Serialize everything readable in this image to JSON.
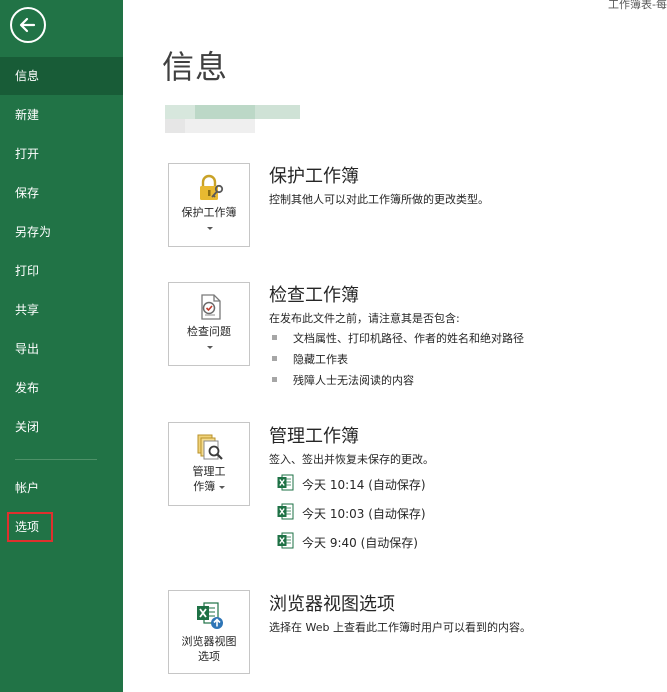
{
  "window": {
    "top_caption": "工作簿表-每"
  },
  "sidebar": {
    "items": [
      {
        "id": "info",
        "label": "信息"
      },
      {
        "id": "new",
        "label": "新建"
      },
      {
        "id": "open",
        "label": "打开"
      },
      {
        "id": "save",
        "label": "保存"
      },
      {
        "id": "save-as",
        "label": "另存为"
      },
      {
        "id": "print",
        "label": "打印"
      },
      {
        "id": "share",
        "label": "共享"
      },
      {
        "id": "export",
        "label": "导出"
      },
      {
        "id": "publish",
        "label": "发布"
      },
      {
        "id": "close",
        "label": "关闭"
      },
      {
        "id": "account",
        "label": "帐户"
      },
      {
        "id": "options",
        "label": "选项"
      }
    ],
    "active": "信息",
    "highlighted": "选项"
  },
  "main": {
    "title": "信息",
    "protect": {
      "card_label": "保护工作簿",
      "title": "保护工作簿",
      "description": "控制其他人可以对此工作簿所做的更改类型。"
    },
    "inspect": {
      "card_label": "检查问题",
      "title": "检查工作簿",
      "description": "在发布此文件之前，请注意其是否包含:",
      "bullets": [
        "文档属性、打印机路径、作者的姓名和绝对路径",
        "隐藏工作表",
        "残障人士无法阅读的内容"
      ]
    },
    "manage": {
      "card_label_line1": "管理工",
      "card_label_line2": "作簿",
      "title": "管理工作簿",
      "description": "签入、签出并恢复未保存的更改。",
      "versions": [
        "今天 10:14 (自动保存)",
        "今天 10:03 (自动保存)",
        "今天 9:40 (自动保存)"
      ]
    },
    "browser": {
      "card_label_line1": "浏览器视图",
      "card_label_line2": "选项",
      "title": "浏览器视图选项",
      "description": "选择在 Web 上查看此工作簿时用户可以看到的内容。"
    }
  },
  "colors": {
    "sidebar_bg": "#217346",
    "sidebar_active": "#185c37",
    "highlight_border": "#e0302e",
    "excel_green": "#1e7145"
  }
}
